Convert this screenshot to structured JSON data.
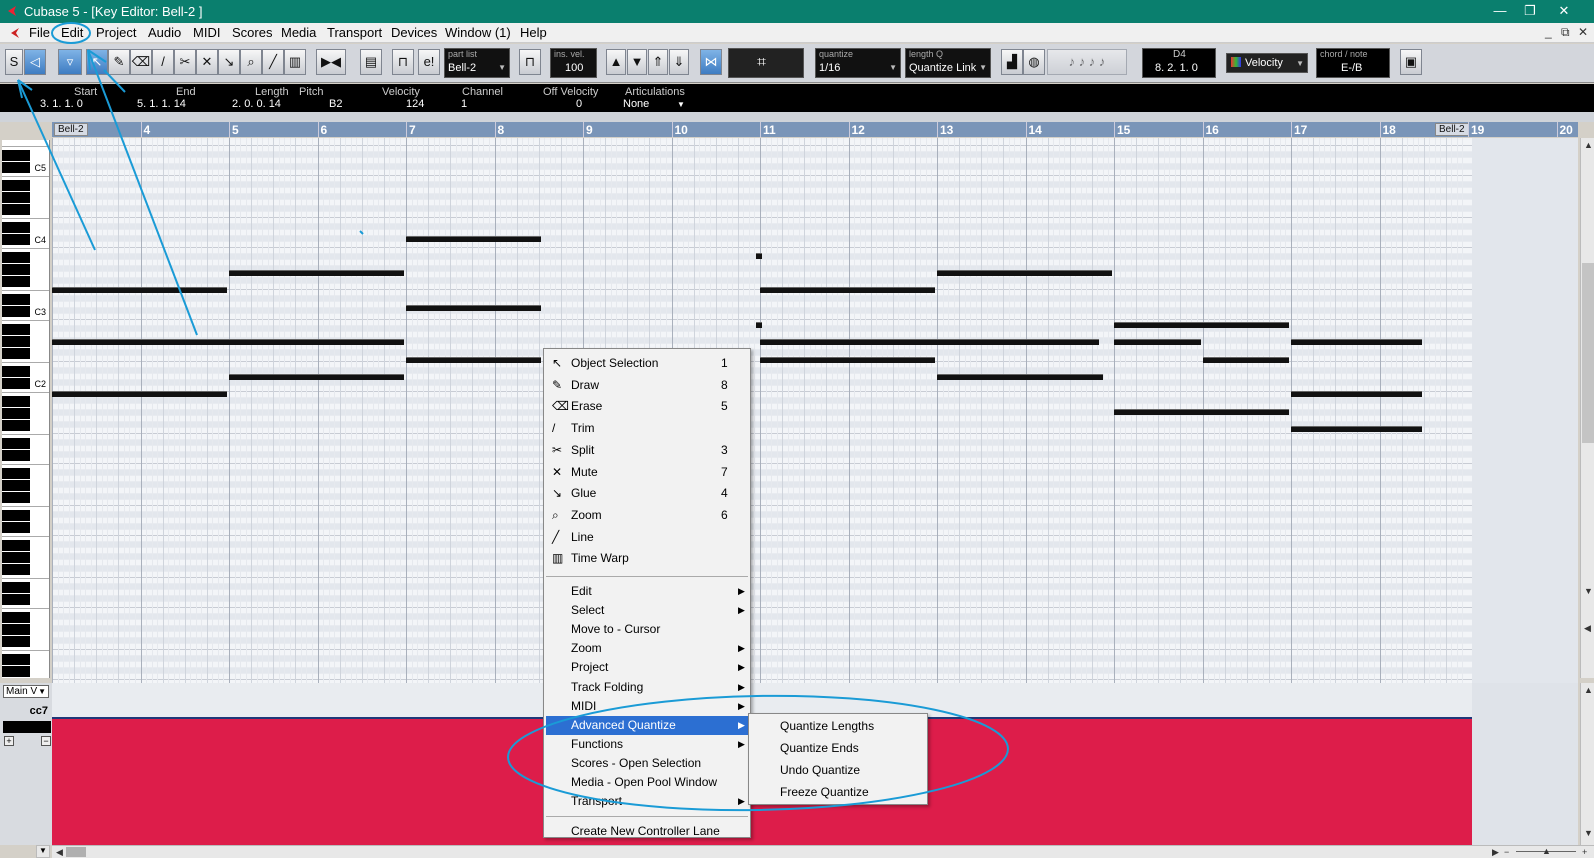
{
  "window": {
    "title": "Cubase 5 - [Key Editor: Bell-2 ]",
    "minimize_glyph": "—",
    "restore_glyph": "❐",
    "close_glyph": "✕"
  },
  "menubar": {
    "items": [
      "File",
      "Edit",
      "Project",
      "Audio",
      "MIDI",
      "Scores",
      "Media",
      "Transport",
      "Devices",
      "Window (1)",
      "Help"
    ],
    "mdi_minimize": "_",
    "mdi_restore": "⧉",
    "mdi_close": "✕"
  },
  "toolbar": {
    "part_list": {
      "label": "part list",
      "value": "Bell-2"
    },
    "ins_vel": {
      "label": "ins. vel.",
      "value": "100"
    },
    "quantize": {
      "label": "quantize",
      "value": "1/16"
    },
    "length_q": {
      "label": "length Q",
      "value": "Quantize Link"
    },
    "mouse_pos": {
      "label": "D4",
      "value": "8. 2. 1.   0"
    },
    "velocity_select": "Velocity",
    "chord_note": {
      "label": "chord / note",
      "value": "E-/B"
    },
    "edit_label": "e!",
    "grid_glyph": "⌗"
  },
  "infoline": {
    "headers": [
      "Start",
      "End",
      "Length",
      "Pitch",
      "Velocity",
      "Channel",
      "Off Velocity",
      "Articulations"
    ],
    "values": [
      "3. 1. 1.   0",
      "5. 1. 1. 14",
      "2. 0. 0. 14",
      "B2",
      "124",
      "1",
      "0",
      "None"
    ]
  },
  "ruler": {
    "marks": [
      "4",
      "5",
      "6",
      "7",
      "8",
      "9",
      "10",
      "11",
      "12",
      "13",
      "14",
      "15",
      "16",
      "17",
      "18",
      "19",
      "20"
    ],
    "part_start": "Bell-2",
    "part_end": "Bell-2"
  },
  "keyboard": {
    "octaves": [
      "C5",
      "C4",
      "C3",
      "C2"
    ]
  },
  "controller": {
    "lane_select": "Main V",
    "cc_label": "cc7",
    "plus": "+",
    "minus": "−"
  },
  "context_menu": {
    "tools": [
      {
        "label": "Object Selection",
        "key": "1",
        "icon": "arrow-icon"
      },
      {
        "label": "Draw",
        "key": "8",
        "icon": "pencil-icon"
      },
      {
        "label": "Erase",
        "key": "5",
        "icon": "eraser-icon"
      },
      {
        "label": "Trim",
        "key": "",
        "icon": "knife-icon"
      },
      {
        "label": "Split",
        "key": "3",
        "icon": "scissors-icon"
      },
      {
        "label": "Mute",
        "key": "7",
        "icon": "x-icon"
      },
      {
        "label": "Glue",
        "key": "4",
        "icon": "glue-icon"
      },
      {
        "label": "Zoom",
        "key": "6",
        "icon": "magnifier-icon"
      },
      {
        "label": "Line",
        "key": "",
        "icon": "line-icon"
      },
      {
        "label": "Time Warp",
        "key": "",
        "icon": "timewarp-icon"
      }
    ],
    "submenus": [
      "Edit",
      "Select",
      "Move to - Cursor",
      "Zoom",
      "Project",
      "Track Folding",
      "MIDI",
      "Advanced Quantize",
      "Functions",
      "Scores - Open Selection",
      "Media - Open Pool Window",
      "Transport"
    ],
    "last": "Create New Controller Lane",
    "submenu_arrow": "▶"
  },
  "advanced_quantize_submenu": [
    "Quantize Lengths",
    "Quantize Ends",
    "Undo Quantize",
    "Freeze Quantize"
  ],
  "notes": [
    {
      "start": 3.0,
      "length": 2.0,
      "row": 18
    },
    {
      "start": 3.0,
      "length": 4.0,
      "row": 21
    },
    {
      "start": 3.0,
      "length": 2.0,
      "row": 24
    },
    {
      "start": 5.0,
      "length": 2.0,
      "row": 17
    },
    {
      "start": 5.0,
      "length": 2.0,
      "row": 23
    },
    {
      "start": 7.0,
      "length": 1.55,
      "row": 15
    },
    {
      "start": 7.0,
      "length": 1.55,
      "row": 19
    },
    {
      "start": 7.0,
      "length": 1.55,
      "row": 22
    },
    {
      "start": 10.95,
      "length": 0.1,
      "row": 16
    },
    {
      "start": 10.95,
      "length": 0.1,
      "row": 20
    },
    {
      "start": 11.0,
      "length": 2.0,
      "row": 18
    },
    {
      "start": 11.0,
      "length": 3.85,
      "row": 21
    },
    {
      "start": 11.0,
      "length": 2.0,
      "row": 22
    },
    {
      "start": 13.0,
      "length": 2.0,
      "row": 17
    },
    {
      "start": 13.0,
      "length": 1.9,
      "row": 23
    },
    {
      "start": 15.0,
      "length": 2.0,
      "row": 20
    },
    {
      "start": 15.0,
      "length": 1.0,
      "row": 21
    },
    {
      "start": 15.0,
      "length": 2.0,
      "row": 25
    },
    {
      "start": 16.0,
      "length": 1.0,
      "row": 22
    },
    {
      "start": 17.0,
      "length": 1.5,
      "row": 21
    },
    {
      "start": 17.0,
      "length": 1.5,
      "row": 24
    },
    {
      "start": 17.0,
      "length": 1.5,
      "row": 26
    }
  ],
  "colors": {
    "accent_highlight": "#2c6fd2",
    "controller_lane": "#dd1d4a",
    "annotation": "#1a9bd6",
    "ruler": "#7a95b8"
  }
}
